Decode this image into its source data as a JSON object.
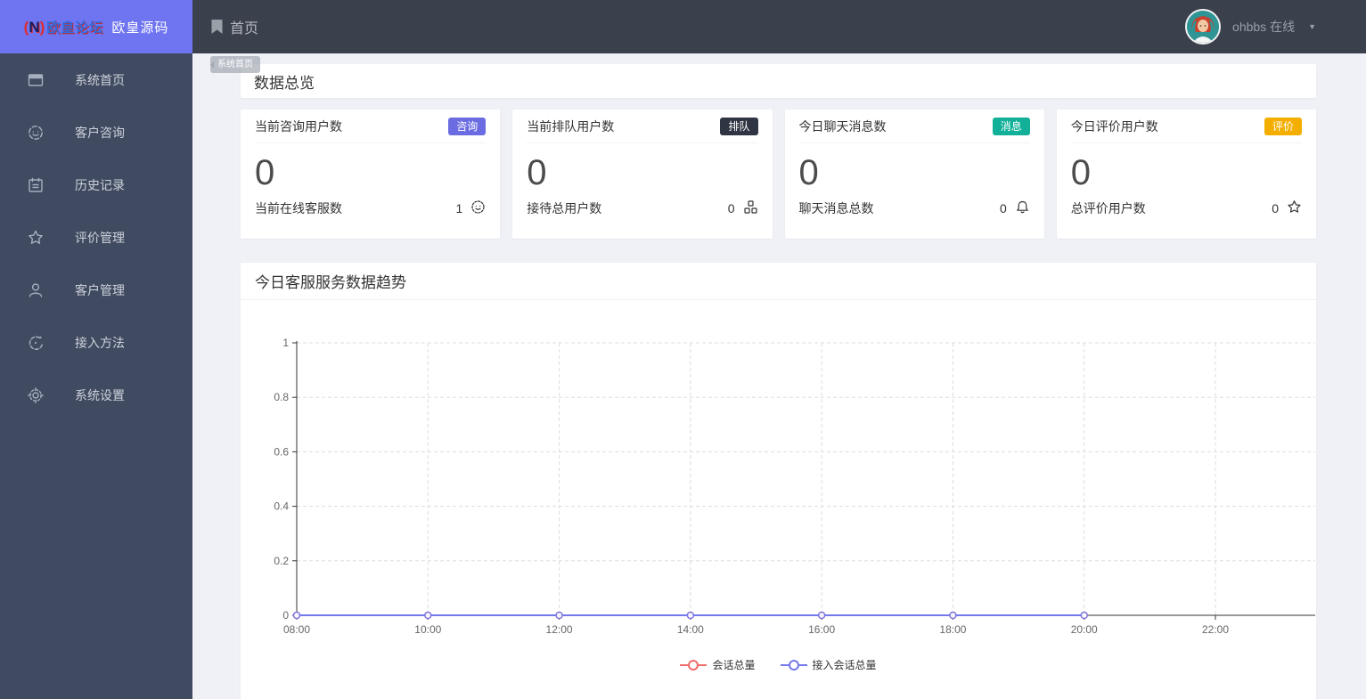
{
  "brand": {
    "logo_paren_left": "(",
    "logo_n": "N",
    "logo_paren_right": ")",
    "logo_text": "欧皇论坛",
    "logo_title": "欧皇源码"
  },
  "navbar": {
    "home_label": "首页",
    "user_name": "ohbbs 在线",
    "caret": "▼"
  },
  "tooltip_tag": "系统首页",
  "sidebar": {
    "items": [
      {
        "label": "系统首页"
      },
      {
        "label": "客户咨询"
      },
      {
        "label": "历史记录"
      },
      {
        "label": "评价管理"
      },
      {
        "label": "客户管理"
      },
      {
        "label": "接入方法"
      },
      {
        "label": "系统设置"
      }
    ]
  },
  "overview": {
    "title": "数据总览",
    "cards": [
      {
        "label": "当前咨询用户数",
        "badge": "咨询",
        "badge_color": "#6b6ce2",
        "value": "0",
        "footer_label": "当前在线客服数",
        "footer_value": "1"
      },
      {
        "label": "当前排队用户数",
        "badge": "排队",
        "badge_color": "#2f3542",
        "value": "0",
        "footer_label": "接待总用户数",
        "footer_value": "0"
      },
      {
        "label": "今日聊天消息数",
        "badge": "消息",
        "badge_color": "#12b098",
        "value": "0",
        "footer_label": "聊天消息总数",
        "footer_value": "0"
      },
      {
        "label": "今日评价用户数",
        "badge": "评价",
        "badge_color": "#f3ae00",
        "value": "0",
        "footer_label": "总评价用户数",
        "footer_value": "0"
      }
    ]
  },
  "chart_card": {
    "title": "今日客服服务数据趋势"
  },
  "chart_data": {
    "type": "line",
    "x": [
      "08:00",
      "10:00",
      "12:00",
      "14:00",
      "16:00",
      "18:00",
      "20:00",
      "22:00"
    ],
    "series": [
      {
        "name": "会话总量",
        "color": "#f06c6c",
        "values": [
          0,
          0,
          0,
          0,
          0,
          0,
          0
        ]
      },
      {
        "name": "接入会话总量",
        "color": "#7478ec",
        "values": [
          0,
          0,
          0,
          0,
          0,
          0,
          0
        ]
      }
    ],
    "ylim": [
      0,
      1
    ],
    "yticks": [
      0,
      0.2,
      0.4,
      0.6,
      0.8,
      1
    ],
    "grid": true,
    "grid_style": "dashed",
    "legend_position": "bottom",
    "axis_color": "#333333",
    "gridline_color": "#dddddd",
    "tick_label_color": "#666666"
  },
  "colors": {
    "brand_purple": "#6f74f0",
    "topbar_bg": "#3a404c",
    "sidebar_bg": "#404a60",
    "content_bg": "#eff1f6",
    "panel_bg": "#ffffff"
  }
}
